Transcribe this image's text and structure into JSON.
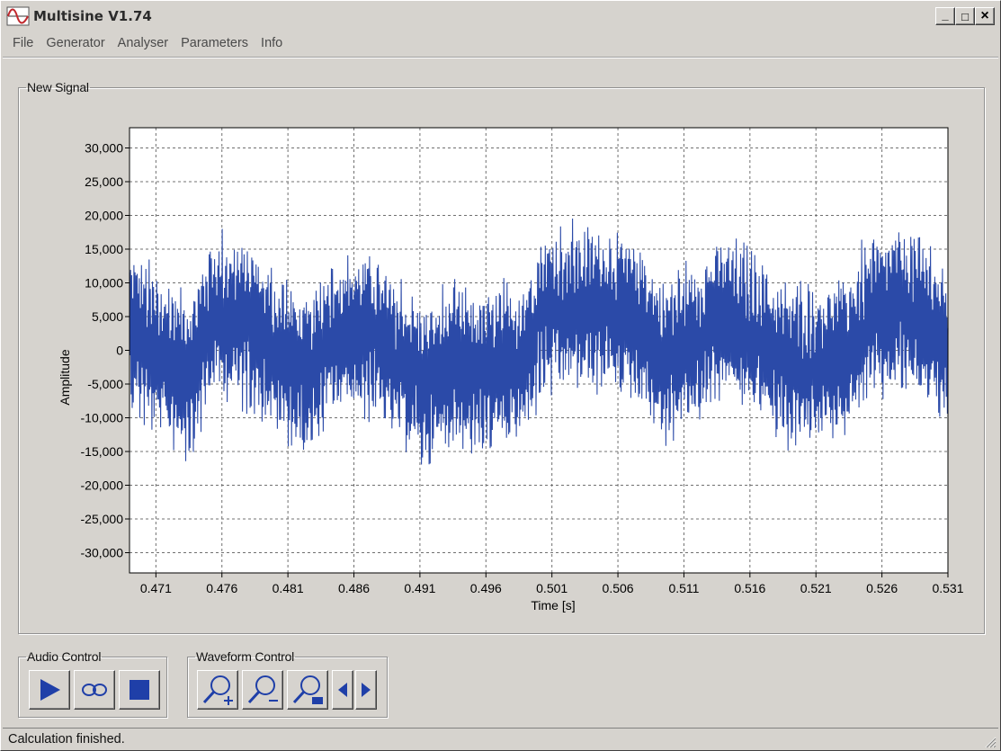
{
  "window": {
    "title": "Multisine V1.74"
  },
  "window_controls": {
    "minimize": "_",
    "maximize": "□",
    "close": "×"
  },
  "menu": [
    "File",
    "Generator",
    "Analyser",
    "Parameters",
    "Info"
  ],
  "signal_group": {
    "label": "New Signal"
  },
  "audio_group": {
    "label": "Audio Control",
    "buttons": [
      {
        "name": "play",
        "icon": "play-icon"
      },
      {
        "name": "loop",
        "icon": "loop-icon"
      },
      {
        "name": "stop",
        "icon": "stop-icon"
      }
    ]
  },
  "waveform_group": {
    "label": "Waveform Control",
    "buttons": [
      {
        "name": "zoom-in",
        "icon": "zoom-in-icon"
      },
      {
        "name": "zoom-out",
        "icon": "zoom-out-icon"
      },
      {
        "name": "zoom-fit",
        "icon": "zoom-fit-icon"
      },
      {
        "name": "scroll-left",
        "icon": "arrow-left-icon"
      },
      {
        "name": "scroll-right",
        "icon": "arrow-right-icon"
      }
    ]
  },
  "status": {
    "text": "Calculation finished."
  },
  "colors": {
    "signal": "#2b4aa8",
    "window": "#d6d3ce",
    "grid": "#707070"
  },
  "chart_data": {
    "type": "line",
    "title": "",
    "xlabel": "Time [s]",
    "ylabel": "Amplitude",
    "xlim": [
      0.469,
      0.531
    ],
    "ylim": [
      -33000,
      33000
    ],
    "x_ticks": [
      0.471,
      0.476,
      0.481,
      0.486,
      0.491,
      0.496,
      0.501,
      0.506,
      0.511,
      0.516,
      0.521,
      0.526,
      0.531
    ],
    "x_tick_labels": [
      "0.471",
      "0.476",
      "0.481",
      "0.486",
      "0.491",
      "0.496",
      "0.501",
      "0.506",
      "0.511",
      "0.516",
      "0.521",
      "0.526",
      "0.531"
    ],
    "y_ticks": [
      30000,
      25000,
      20000,
      15000,
      10000,
      5000,
      0,
      -5000,
      -10000,
      -15000,
      -20000,
      -25000,
      -30000
    ],
    "y_tick_labels": [
      "30,000",
      "25,000",
      "20,000",
      "15,000",
      "10,000",
      "5,000",
      "0",
      "-5,000",
      "-10,000",
      "-15,000",
      "-20,000",
      "-25,000",
      "-30,000"
    ],
    "grid": true,
    "series": [
      {
        "x": [
          0.469,
          0.4715,
          0.4735,
          0.4755,
          0.478,
          0.4805,
          0.4825,
          0.4845,
          0.487,
          0.4895,
          0.4915,
          0.4935,
          0.496,
          0.4985,
          0.5005,
          0.5025,
          0.505,
          0.5075,
          0.5095,
          0.5115,
          0.514,
          0.5165,
          0.5185,
          0.5205,
          0.523,
          0.5255,
          0.5275,
          0.5295,
          0.531
        ],
        "y": [
          3000,
          -1500,
          -3000,
          5000,
          4000,
          -1000,
          -4000,
          2000,
          2500,
          -2000,
          -5000,
          -2500,
          -3500,
          -2000,
          5500,
          6000,
          6000,
          4000,
          -1500,
          1000,
          4500,
          2000,
          -2000,
          -2500,
          -1000,
          4500,
          6000,
          4000,
          -1000
        ],
        "noise_amplitude": 11000
      }
    ]
  }
}
